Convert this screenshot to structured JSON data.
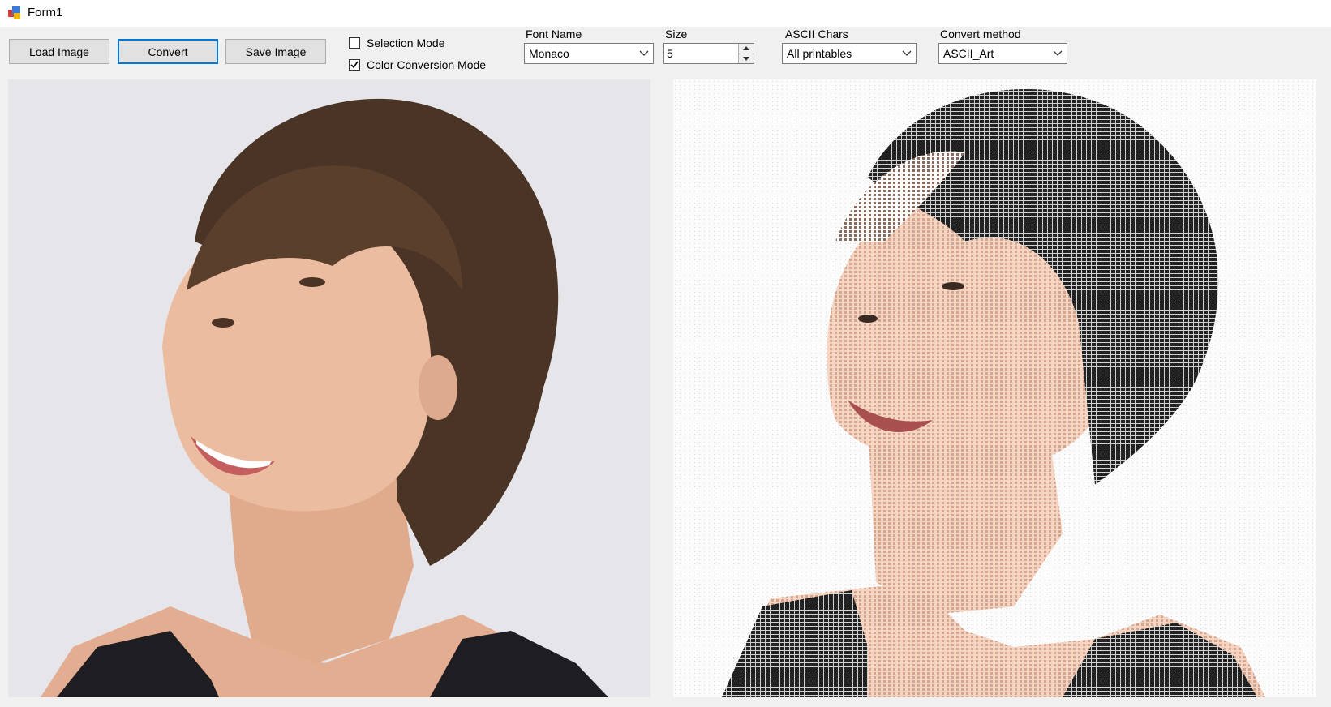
{
  "window": {
    "title": "Form1"
  },
  "toolbar": {
    "load_label": "Load Image",
    "convert_label": "Convert",
    "save_label": "Save Image"
  },
  "options": {
    "selection_mode": {
      "label": "Selection Mode",
      "checked": false
    },
    "color_conversion_mode": {
      "label": "Color Conversion Mode",
      "checked": true
    }
  },
  "font_name": {
    "label": "Font Name",
    "value": "Monaco"
  },
  "size": {
    "label": "Size",
    "value": "5"
  },
  "ascii_chars": {
    "label": "ASCII Chars",
    "value": "All printables"
  },
  "convert_method": {
    "label": "Convert method",
    "value": "ASCII_Art"
  },
  "colors": {
    "accent": "#0078d7",
    "window_bg": "#f0f0f0",
    "photo_bg": "#e6e6ea",
    "skin": "#e9b79a",
    "hair": "#4a3426",
    "top": "#1d1d22"
  },
  "icons": [
    "app-form-icon",
    "chevron-down-icon",
    "spin-up-icon",
    "spin-down-icon",
    "checkmark-icon"
  ]
}
